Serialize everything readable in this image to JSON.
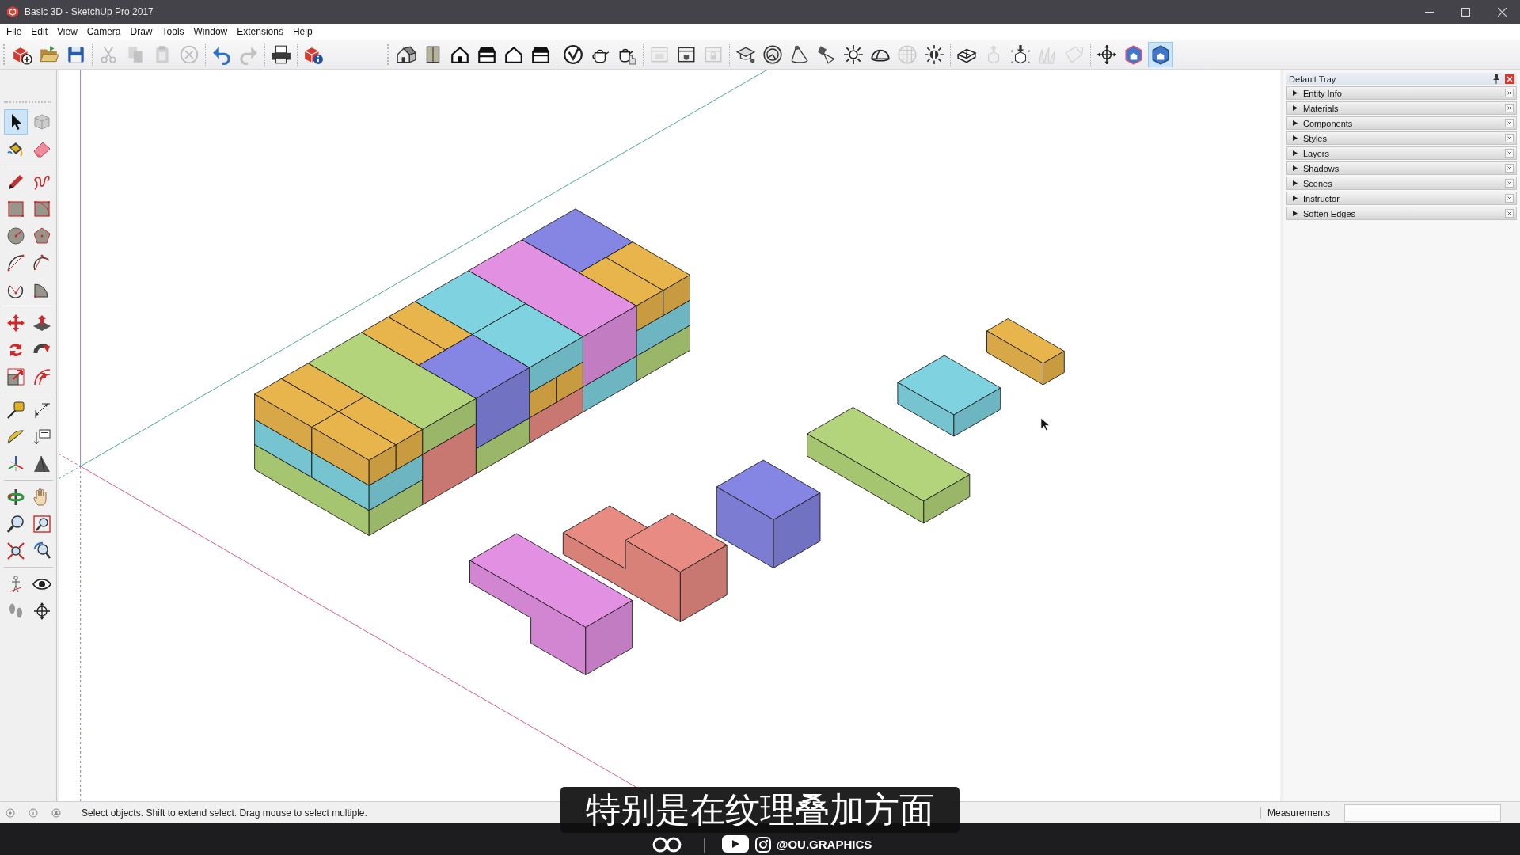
{
  "window": {
    "title": "Basic 3D - SketchUp Pro 2017"
  },
  "menu": [
    "File",
    "Edit",
    "View",
    "Camera",
    "Draw",
    "Tools",
    "Window",
    "Extensions",
    "Help"
  ],
  "toolbars": [
    {
      "groups": [
        {
          "items": [
            {
              "kind": "new",
              "disabled": false,
              "selected": false
            },
            {
              "kind": "open",
              "disabled": false,
              "selected": false
            },
            {
              "kind": "save",
              "disabled": false,
              "selected": false
            }
          ]
        },
        {
          "items": [
            {
              "kind": "cut",
              "disabled": true,
              "selected": false
            },
            {
              "kind": "copy",
              "disabled": true,
              "selected": false
            },
            {
              "kind": "paste",
              "disabled": true,
              "selected": false
            },
            {
              "kind": "erase",
              "disabled": true,
              "selected": false
            }
          ]
        },
        {
          "items": [
            {
              "kind": "undo",
              "disabled": false,
              "selected": false
            },
            {
              "kind": "redo",
              "disabled": true,
              "selected": false
            }
          ]
        },
        {
          "items": [
            {
              "kind": "print",
              "disabled": false,
              "selected": false
            }
          ]
        },
        {
          "items": [
            {
              "kind": "info",
              "disabled": false,
              "selected": false
            }
          ]
        }
      ]
    },
    {
      "groups": [
        {
          "items": [
            {
              "kind": "iso",
              "disabled": false,
              "selected": false
            },
            {
              "kind": "top",
              "disabled": false,
              "selected": false
            },
            {
              "kind": "front",
              "disabled": false,
              "selected": false
            },
            {
              "kind": "right",
              "disabled": false,
              "selected": false
            },
            {
              "kind": "back",
              "disabled": false,
              "selected": false
            },
            {
              "kind": "left",
              "disabled": false,
              "selected": false
            }
          ]
        },
        {
          "items": [
            {
              "kind": "warehouse",
              "disabled": false,
              "selected": false
            },
            {
              "kind": "share",
              "disabled": false,
              "selected": false
            },
            {
              "kind": "sharecomp",
              "disabled": false,
              "selected": false
            }
          ]
        },
        {
          "items": [
            {
              "kind": "window",
              "disabled": true,
              "selected": false
            },
            {
              "kind": "windowpot",
              "disabled": false,
              "selected": false
            },
            {
              "kind": "windowlock",
              "disabled": true,
              "selected": false
            }
          ]
        },
        {
          "items": [
            {
              "kind": "cap",
              "disabled": false,
              "selected": false
            },
            {
              "kind": "orbitglobe",
              "disabled": false,
              "selected": false
            },
            {
              "kind": "cone",
              "disabled": false,
              "selected": false
            },
            {
              "kind": "lamp",
              "disabled": false,
              "selected": false
            },
            {
              "kind": "sun",
              "disabled": false,
              "selected": false
            },
            {
              "kind": "dome",
              "disabled": false,
              "selected": false
            },
            {
              "kind": "grid",
              "disabled": true,
              "selected": false
            },
            {
              "kind": "bulb",
              "disabled": false,
              "selected": false
            }
          ]
        },
        {
          "items": [
            {
              "kind": "mesh",
              "disabled": false,
              "selected": false
            },
            {
              "kind": "cubeup",
              "disabled": true,
              "selected": false
            },
            {
              "kind": "cubedown",
              "disabled": false,
              "selected": false
            },
            {
              "kind": "grass",
              "disabled": true,
              "selected": false
            },
            {
              "kind": "sheet",
              "disabled": true,
              "selected": false
            }
          ]
        },
        {
          "items": [
            {
              "kind": "crosshair",
              "disabled": false,
              "selected": false
            },
            {
              "kind": "housecube",
              "disabled": false,
              "selected": false
            },
            {
              "kind": "houseblock",
              "disabled": false,
              "selected": true
            }
          ]
        }
      ]
    }
  ],
  "tool_palette": {
    "groups": [
      {
        "tools": [
          {
            "kind": "select",
            "selected": true
          },
          {
            "kind": "component",
            "selected": false
          },
          {
            "kind": "paint",
            "selected": false
          },
          {
            "kind": "eraser",
            "selected": false
          }
        ]
      },
      {
        "tools": [
          {
            "kind": "line",
            "selected": false
          },
          {
            "kind": "freehand",
            "selected": false
          },
          {
            "kind": "rectangle",
            "selected": false
          },
          {
            "kind": "rotrect",
            "selected": false
          },
          {
            "kind": "circle",
            "selected": false
          },
          {
            "kind": "polygon",
            "selected": false
          },
          {
            "kind": "arc",
            "selected": false
          },
          {
            "kind": "arc2",
            "selected": false
          },
          {
            "kind": "arc3",
            "selected": false
          },
          {
            "kind": "pie",
            "selected": false
          }
        ]
      },
      {
        "tools": [
          {
            "kind": "move",
            "selected": false
          },
          {
            "kind": "pushpull",
            "selected": false
          },
          {
            "kind": "rotate",
            "selected": false
          },
          {
            "kind": "followme",
            "selected": false
          },
          {
            "kind": "scale",
            "selected": false
          },
          {
            "kind": "offset",
            "selected": false
          }
        ]
      },
      {
        "tools": [
          {
            "kind": "tape",
            "selected": false
          },
          {
            "kind": "dimension",
            "selected": false
          },
          {
            "kind": "protractor",
            "selected": false
          },
          {
            "kind": "text",
            "selected": false
          },
          {
            "kind": "axes",
            "selected": false
          },
          {
            "kind": "text3d",
            "selected": false
          }
        ]
      },
      {
        "tools": [
          {
            "kind": "orbit",
            "selected": false
          },
          {
            "kind": "pan",
            "selected": false
          },
          {
            "kind": "zoom",
            "selected": false
          },
          {
            "kind": "zoomwindow",
            "selected": false
          },
          {
            "kind": "zoomextents",
            "selected": false
          },
          {
            "kind": "previous",
            "selected": false
          }
        ]
      },
      {
        "tools": [
          {
            "kind": "camera",
            "selected": false
          },
          {
            "kind": "lookaround",
            "selected": false
          },
          {
            "kind": "walk",
            "selected": false
          },
          {
            "kind": "section",
            "selected": false
          }
        ]
      }
    ]
  },
  "tray": {
    "title": "Default Tray",
    "panels": [
      {
        "label": "Entity Info",
        "expanded": false
      },
      {
        "label": "Materials",
        "expanded": false
      },
      {
        "label": "Components",
        "expanded": false
      },
      {
        "label": "Styles",
        "expanded": false
      },
      {
        "label": "Layers",
        "expanded": false
      },
      {
        "label": "Shadows",
        "expanded": false
      },
      {
        "label": "Scenes",
        "expanded": false
      },
      {
        "label": "Instructor",
        "expanded": false
      },
      {
        "label": "Soften Edges",
        "expanded": false
      }
    ]
  },
  "status_bar": {
    "hint": "Select objects. Shift to extend select. Drag mouse to select multiple.",
    "measurements_label": "Measurements"
  },
  "caption": "特别是在纹理叠加方面",
  "channel_bar": {
    "handle": "@OU.GRAPHICS"
  }
}
